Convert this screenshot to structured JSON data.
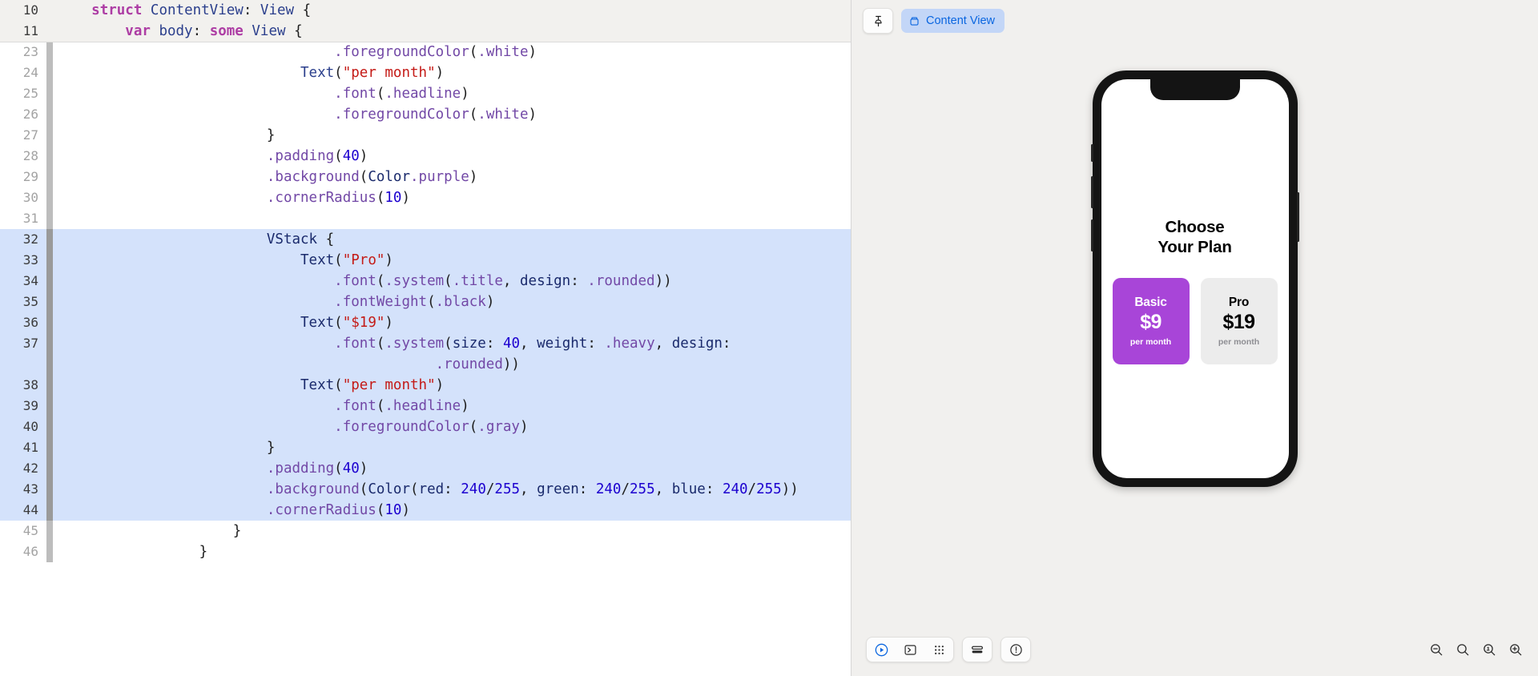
{
  "editor": {
    "sticky_lines": [
      {
        "num": "10",
        "indent": 1,
        "tokens": [
          {
            "t": "struct ",
            "c": "kw"
          },
          {
            "t": "ContentView",
            "c": "typ"
          },
          {
            "t": ": ",
            "c": "plain"
          },
          {
            "t": "View",
            "c": "typ"
          },
          {
            "t": " {",
            "c": "plain"
          }
        ]
      },
      {
        "num": "11",
        "indent": 2,
        "tokens": [
          {
            "t": "var ",
            "c": "kw"
          },
          {
            "t": "body",
            "c": "typ"
          },
          {
            "t": ": ",
            "c": "plain"
          },
          {
            "t": "some ",
            "c": "kw"
          },
          {
            "t": "View",
            "c": "typ"
          },
          {
            "t": " {",
            "c": "plain"
          }
        ]
      }
    ],
    "lines": [
      {
        "num": "23",
        "selected": false,
        "gut": "g1",
        "indent": 8,
        "tokens": [
          {
            "t": ".foregroundColor",
            "c": "fn"
          },
          {
            "t": "(",
            "c": "plain"
          },
          {
            "t": ".white",
            "c": "fn"
          },
          {
            "t": ")",
            "c": "plain"
          }
        ]
      },
      {
        "num": "24",
        "selected": false,
        "gut": "g1",
        "indent": 7,
        "tokens": [
          {
            "t": "Text",
            "c": "typ"
          },
          {
            "t": "(",
            "c": "plain"
          },
          {
            "t": "\"per month\"",
            "c": "str"
          },
          {
            "t": ")",
            "c": "plain"
          }
        ]
      },
      {
        "num": "25",
        "selected": false,
        "gut": "g1",
        "indent": 8,
        "tokens": [
          {
            "t": ".font",
            "c": "fn"
          },
          {
            "t": "(",
            "c": "plain"
          },
          {
            "t": ".headline",
            "c": "fn"
          },
          {
            "t": ")",
            "c": "plain"
          }
        ]
      },
      {
        "num": "26",
        "selected": false,
        "gut": "g1",
        "indent": 8,
        "tokens": [
          {
            "t": ".foregroundColor",
            "c": "fn"
          },
          {
            "t": "(",
            "c": "plain"
          },
          {
            "t": ".white",
            "c": "fn"
          },
          {
            "t": ")",
            "c": "plain"
          }
        ]
      },
      {
        "num": "27",
        "selected": false,
        "gut": "g1",
        "indent": 6,
        "tokens": [
          {
            "t": "}",
            "c": "plain"
          }
        ]
      },
      {
        "num": "28",
        "selected": false,
        "gut": "g1",
        "indent": 6,
        "tokens": [
          {
            "t": ".padding",
            "c": "fn"
          },
          {
            "t": "(",
            "c": "plain"
          },
          {
            "t": "40",
            "c": "num"
          },
          {
            "t": ")",
            "c": "plain"
          }
        ]
      },
      {
        "num": "29",
        "selected": false,
        "gut": "g1",
        "indent": 6,
        "tokens": [
          {
            "t": ".background",
            "c": "fn"
          },
          {
            "t": "(",
            "c": "plain"
          },
          {
            "t": "Color",
            "c": "typ2"
          },
          {
            "t": ".purple",
            "c": "fn"
          },
          {
            "t": ")",
            "c": "plain"
          }
        ]
      },
      {
        "num": "30",
        "selected": false,
        "gut": "g1",
        "indent": 6,
        "tokens": [
          {
            "t": ".cornerRadius",
            "c": "fn"
          },
          {
            "t": "(",
            "c": "plain"
          },
          {
            "t": "10",
            "c": "num"
          },
          {
            "t": ")",
            "c": "plain"
          }
        ]
      },
      {
        "num": "31",
        "selected": false,
        "gut": "g1",
        "indent": 0,
        "tokens": []
      },
      {
        "num": "32",
        "selected": true,
        "gut": "g2",
        "indent": 6,
        "tokens": [
          {
            "t": "VStack",
            "c": "typ2"
          },
          {
            "t": " {",
            "c": "plain"
          }
        ]
      },
      {
        "num": "33",
        "selected": true,
        "gut": "g2",
        "indent": 7,
        "tokens": [
          {
            "t": "Text",
            "c": "typ2"
          },
          {
            "t": "(",
            "c": "plain"
          },
          {
            "t": "\"Pro\"",
            "c": "str"
          },
          {
            "t": ")",
            "c": "plain"
          }
        ]
      },
      {
        "num": "34",
        "selected": true,
        "gut": "g2",
        "indent": 8,
        "tokens": [
          {
            "t": ".font",
            "c": "fn"
          },
          {
            "t": "(",
            "c": "plain"
          },
          {
            "t": ".system",
            "c": "fn"
          },
          {
            "t": "(",
            "c": "plain"
          },
          {
            "t": ".title",
            "c": "fn"
          },
          {
            "t": ", ",
            "c": "plain"
          },
          {
            "t": "design",
            "c": "typ2"
          },
          {
            "t": ": ",
            "c": "plain"
          },
          {
            "t": ".rounded",
            "c": "fn"
          },
          {
            "t": "))",
            "c": "plain"
          }
        ]
      },
      {
        "num": "35",
        "selected": true,
        "gut": "g2",
        "indent": 8,
        "tokens": [
          {
            "t": ".fontWeight",
            "c": "fn"
          },
          {
            "t": "(",
            "c": "plain"
          },
          {
            "t": ".black",
            "c": "fn"
          },
          {
            "t": ")",
            "c": "plain"
          }
        ]
      },
      {
        "num": "36",
        "selected": true,
        "gut": "g2",
        "indent": 7,
        "tokens": [
          {
            "t": "Text",
            "c": "typ2"
          },
          {
            "t": "(",
            "c": "plain"
          },
          {
            "t": "\"$19\"",
            "c": "str"
          },
          {
            "t": ")",
            "c": "plain"
          }
        ]
      },
      {
        "num": "37",
        "selected": true,
        "gut": "g2",
        "indent": 8,
        "tokens": [
          {
            "t": ".font",
            "c": "fn"
          },
          {
            "t": "(",
            "c": "plain"
          },
          {
            "t": ".system",
            "c": "fn"
          },
          {
            "t": "(",
            "c": "plain"
          },
          {
            "t": "size",
            "c": "typ2"
          },
          {
            "t": ": ",
            "c": "plain"
          },
          {
            "t": "40",
            "c": "num"
          },
          {
            "t": ", ",
            "c": "plain"
          },
          {
            "t": "weight",
            "c": "typ2"
          },
          {
            "t": ": ",
            "c": "plain"
          },
          {
            "t": ".heavy",
            "c": "fn"
          },
          {
            "t": ", ",
            "c": "plain"
          },
          {
            "t": "design",
            "c": "typ2"
          },
          {
            "t": ":",
            "c": "plain"
          }
        ]
      },
      {
        "num": "",
        "selected": true,
        "gut": "g2",
        "indent": 11,
        "tokens": [
          {
            "t": ".rounded",
            "c": "fn"
          },
          {
            "t": "))",
            "c": "plain"
          }
        ]
      },
      {
        "num": "38",
        "selected": true,
        "gut": "g2",
        "indent": 7,
        "tokens": [
          {
            "t": "Text",
            "c": "typ2"
          },
          {
            "t": "(",
            "c": "plain"
          },
          {
            "t": "\"per month\"",
            "c": "str"
          },
          {
            "t": ")",
            "c": "plain"
          }
        ]
      },
      {
        "num": "39",
        "selected": true,
        "gut": "g2",
        "indent": 8,
        "tokens": [
          {
            "t": ".font",
            "c": "fn"
          },
          {
            "t": "(",
            "c": "plain"
          },
          {
            "t": ".headline",
            "c": "fn"
          },
          {
            "t": ")",
            "c": "plain"
          }
        ]
      },
      {
        "num": "40",
        "selected": true,
        "gut": "g2",
        "indent": 8,
        "tokens": [
          {
            "t": ".foregroundColor",
            "c": "fn"
          },
          {
            "t": "(",
            "c": "plain"
          },
          {
            "t": ".gray",
            "c": "fn"
          },
          {
            "t": ")",
            "c": "plain"
          }
        ]
      },
      {
        "num": "41",
        "selected": true,
        "gut": "g2",
        "indent": 6,
        "tokens": [
          {
            "t": "}",
            "c": "plain"
          }
        ]
      },
      {
        "num": "42",
        "selected": true,
        "gut": "g2",
        "indent": 6,
        "tokens": [
          {
            "t": ".padding",
            "c": "fn"
          },
          {
            "t": "(",
            "c": "plain"
          },
          {
            "t": "40",
            "c": "num"
          },
          {
            "t": ")",
            "c": "plain"
          }
        ]
      },
      {
        "num": "43",
        "selected": true,
        "gut": "g2",
        "indent": 6,
        "tokens": [
          {
            "t": ".background",
            "c": "fn"
          },
          {
            "t": "(",
            "c": "plain"
          },
          {
            "t": "Color",
            "c": "typ2"
          },
          {
            "t": "(",
            "c": "plain"
          },
          {
            "t": "red",
            "c": "typ2"
          },
          {
            "t": ": ",
            "c": "plain"
          },
          {
            "t": "240",
            "c": "num"
          },
          {
            "t": "/",
            "c": "plain"
          },
          {
            "t": "255",
            "c": "num"
          },
          {
            "t": ", ",
            "c": "plain"
          },
          {
            "t": "green",
            "c": "typ2"
          },
          {
            "t": ": ",
            "c": "plain"
          },
          {
            "t": "240",
            "c": "num"
          },
          {
            "t": "/",
            "c": "plain"
          },
          {
            "t": "255",
            "c": "num"
          },
          {
            "t": ", ",
            "c": "plain"
          },
          {
            "t": "blue",
            "c": "typ2"
          },
          {
            "t": ": ",
            "c": "plain"
          },
          {
            "t": "240",
            "c": "num"
          },
          {
            "t": "/",
            "c": "plain"
          },
          {
            "t": "255",
            "c": "num"
          },
          {
            "t": "))",
            "c": "plain"
          }
        ]
      },
      {
        "num": "44",
        "selected": true,
        "gut": "g2",
        "indent": 6,
        "tokens": [
          {
            "t": ".cornerRadius",
            "c": "fn"
          },
          {
            "t": "(",
            "c": "plain"
          },
          {
            "t": "10",
            "c": "num"
          },
          {
            "t": ")",
            "c": "plain"
          }
        ]
      },
      {
        "num": "45",
        "selected": false,
        "gut": "g1",
        "indent": 5,
        "tokens": [
          {
            "t": "}",
            "c": "plain"
          }
        ]
      },
      {
        "num": "46",
        "selected": false,
        "gut": "g1",
        "indent": 4,
        "tokens": [
          {
            "t": "}",
            "c": "plain"
          }
        ]
      }
    ]
  },
  "preview": {
    "pin_icon": "pin-icon",
    "chip_icon": "cube-icon",
    "chip_label": "Content View",
    "device": {
      "heading_line1": "Choose",
      "heading_line2": "Your Plan",
      "cards": [
        {
          "name": "Basic",
          "price": "$9",
          "period": "per month",
          "style": "basic"
        },
        {
          "name": "Pro",
          "price": "$19",
          "period": "per month",
          "style": "pro"
        }
      ]
    },
    "toolbar": {
      "left_buttons": [
        {
          "name": "play-button",
          "icon": "play"
        },
        {
          "name": "inspect-button",
          "icon": "inspect"
        },
        {
          "name": "variants-button",
          "icon": "grid"
        }
      ],
      "device-settings-button": {
        "name": "device-settings-button",
        "icon": "layers"
      },
      "scheme-button": {
        "name": "preview-scheme-button",
        "icon": "circle-slash"
      },
      "zoom_buttons": [
        {
          "name": "zoom-out-button",
          "icon": "zoom-minus"
        },
        {
          "name": "zoom-fit-button",
          "icon": "zoom-plain"
        },
        {
          "name": "zoom-actual-button",
          "icon": "zoom-one"
        },
        {
          "name": "zoom-in-button",
          "icon": "zoom-plus"
        }
      ]
    }
  },
  "colors": {
    "selection": "#d4e2fb",
    "card_purple": "#a845d8",
    "card_gray": "#ececec",
    "chip_bg": "#c3d6f7",
    "chip_fg": "#0a66e0"
  }
}
